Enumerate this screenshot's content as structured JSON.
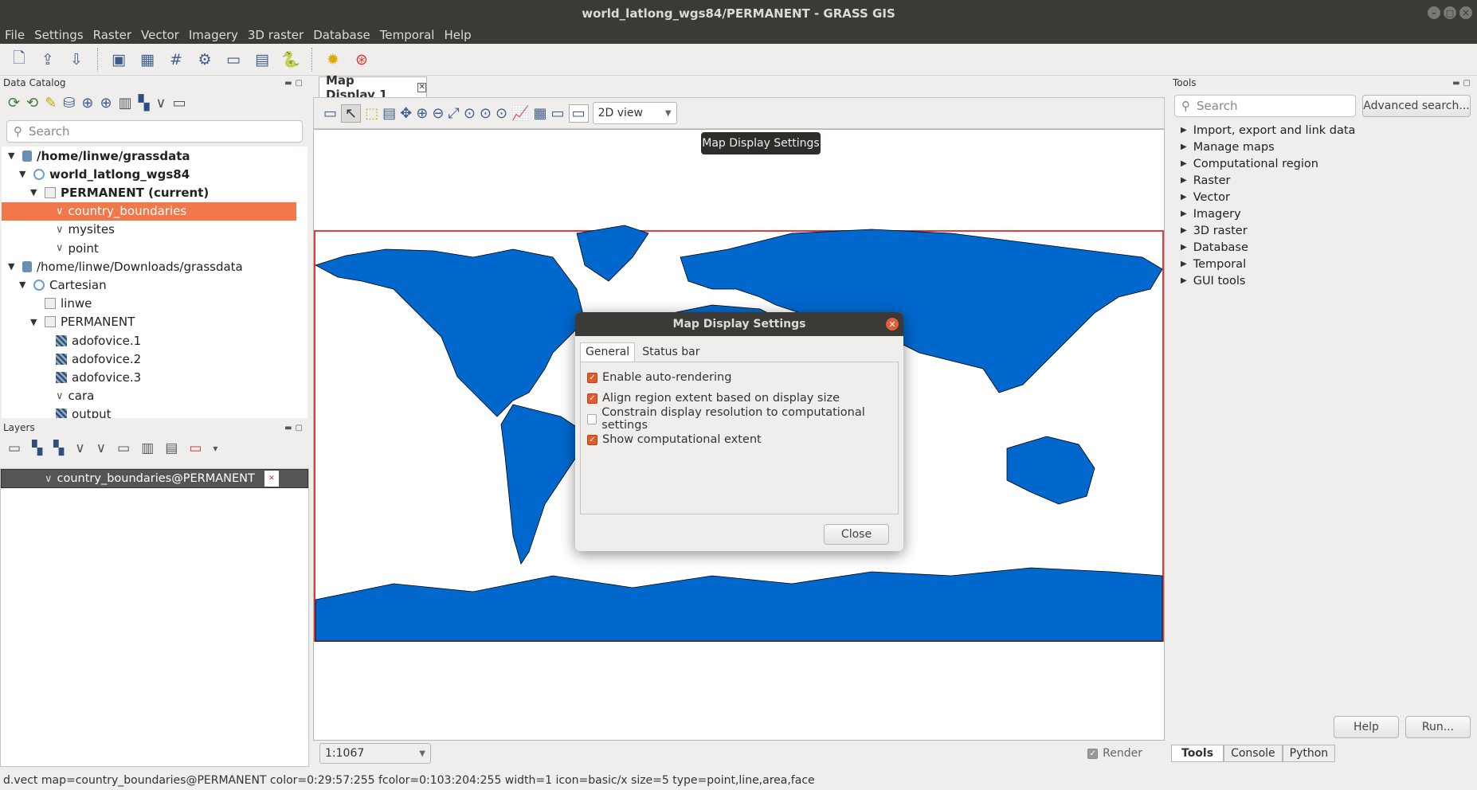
{
  "window": {
    "title": "world_latlong_wgs84/PERMANENT - GRASS GIS"
  },
  "menu": [
    "File",
    "Settings",
    "Raster",
    "Vector",
    "Imagery",
    "3D raster",
    "Database",
    "Temporal",
    "Help"
  ],
  "data_catalog": {
    "title": "Data Catalog",
    "search_placeholder": "Search",
    "tree": [
      {
        "label": "/home/linwe/grassdata",
        "type": "db",
        "bold": true,
        "depth": 0,
        "expanded": true
      },
      {
        "label": "world_latlong_wgs84",
        "type": "location",
        "bold": true,
        "depth": 1,
        "expanded": true
      },
      {
        "label": "PERMANENT  (current)",
        "type": "mapset",
        "bold": true,
        "depth": 2,
        "expanded": true
      },
      {
        "label": "country_boundaries",
        "type": "vector",
        "depth": 3,
        "selected": true
      },
      {
        "label": "mysites",
        "type": "vector",
        "depth": 3
      },
      {
        "label": "point",
        "type": "vector",
        "depth": 3
      },
      {
        "label": "/home/linwe/Downloads/grassdata",
        "type": "db",
        "depth": 0,
        "expanded": true
      },
      {
        "label": "Cartesian",
        "type": "location",
        "depth": 1,
        "expanded": true
      },
      {
        "label": "linwe",
        "type": "mapset",
        "depth": 2
      },
      {
        "label": "PERMANENT",
        "type": "mapset",
        "depth": 2,
        "expanded": true
      },
      {
        "label": "adofovice.1",
        "type": "raster",
        "depth": 3
      },
      {
        "label": "adofovice.2",
        "type": "raster",
        "depth": 3
      },
      {
        "label": "adofovice.3",
        "type": "raster",
        "depth": 3
      },
      {
        "label": "cara",
        "type": "vector",
        "depth": 3
      },
      {
        "label": "output",
        "type": "raster",
        "depth": 3
      }
    ]
  },
  "layers": {
    "title": "Layers",
    "items": [
      {
        "label": "country_boundaries@PERMANENT",
        "checked": true
      }
    ]
  },
  "map_display": {
    "tab_label": "Map Display 1",
    "view_mode": "2D view",
    "tooltip": "Map Display Settings",
    "scale": "1:1067",
    "render_label": "Render"
  },
  "dialog": {
    "title": "Map Display Settings",
    "tabs": [
      "General",
      "Status bar"
    ],
    "options": [
      {
        "label": "Enable auto-rendering",
        "checked": true
      },
      {
        "label": "Align region extent based on display size",
        "checked": true
      },
      {
        "label": "Constrain display resolution to computational settings",
        "checked": false
      },
      {
        "label": "Show computational extent",
        "checked": true
      }
    ],
    "close_label": "Close"
  },
  "tools": {
    "title": "Tools",
    "search_placeholder": "Search",
    "advanced_label": "Advanced search...",
    "categories": [
      "Import, export and link data",
      "Manage maps",
      "Computational region",
      "Raster",
      "Vector",
      "Imagery",
      "3D raster",
      "Database",
      "Temporal",
      "GUI tools"
    ],
    "help_label": "Help",
    "run_label": "Run...",
    "bottom_tabs": [
      "Tools",
      "Console",
      "Python"
    ]
  },
  "status": {
    "command": "d.vect map=country_boundaries@PERMANENT color=0:29:57:255 fcolor=0:103:204:255 width=1 icon=basic/x size=5 type=point,line,area,face"
  },
  "colors": {
    "land": "#0067cc",
    "selection": "#f0784a",
    "region_border": "#e83a3a"
  }
}
